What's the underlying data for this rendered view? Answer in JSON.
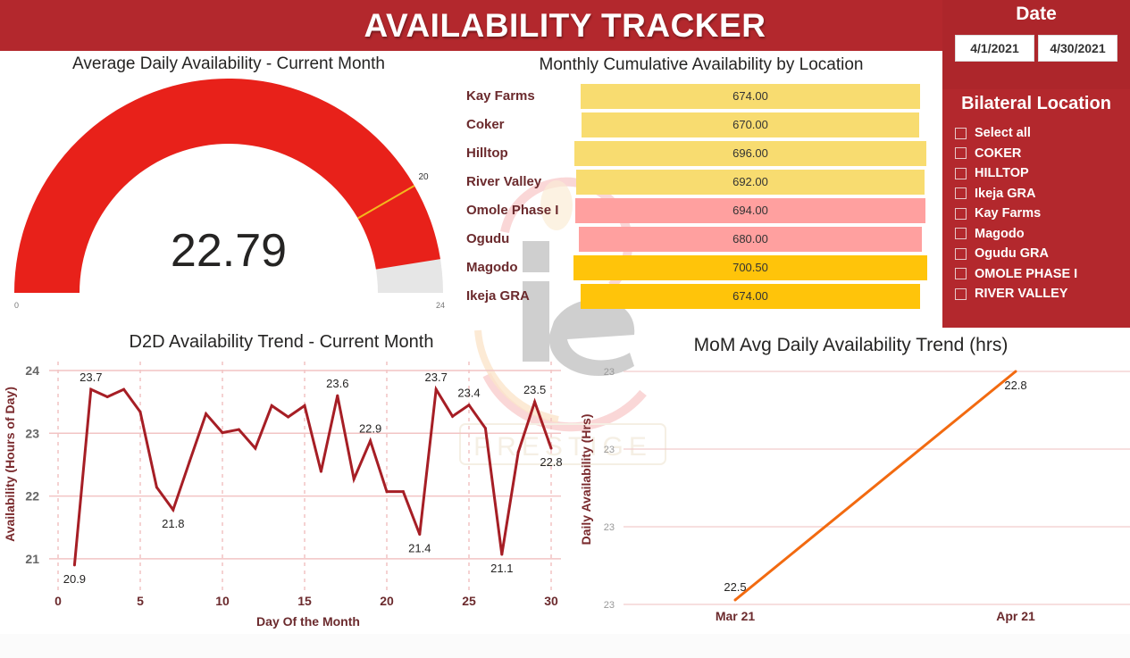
{
  "header": {
    "title": "AVAILABILITY TRACKER",
    "color": "#b3282d"
  },
  "filters": {
    "date": {
      "title": "Date",
      "start": "4/1/2021",
      "end": "4/30/2021"
    },
    "location": {
      "title": "Bilateral Location",
      "items": [
        {
          "label": "Select all",
          "checked": false
        },
        {
          "label": "COKER",
          "checked": false
        },
        {
          "label": "HILLTOP",
          "checked": false
        },
        {
          "label": "Ikeja GRA",
          "checked": false
        },
        {
          "label": "Kay Farms",
          "checked": false
        },
        {
          "label": "Magodo",
          "checked": false
        },
        {
          "label": "Ogudu GRA",
          "checked": false
        },
        {
          "label": "OMOLE PHASE I",
          "checked": false
        },
        {
          "label": "RIVER VALLEY",
          "checked": false
        }
      ]
    }
  },
  "watermark": {
    "logo": "ie-logo",
    "text": "PRESTIGE"
  },
  "chart_data": [
    {
      "type": "gauge",
      "title": "Average Daily Availability - Current Month",
      "value": 22.79,
      "value_label": "22.79",
      "min": 0,
      "min_label": "0",
      "max": 24,
      "max_label": "24",
      "target": 20,
      "target_label": "20",
      "colors": {
        "fill": "#e8211a",
        "track": "#e6e6e6",
        "target": "#f2b81d"
      }
    },
    {
      "type": "bar",
      "title": "Monthly Cumulative Availability by Location",
      "categories": [
        "Kay Farms",
        "Coker",
        "Hilltop",
        "River Valley",
        "Omole Phase I",
        "Ogudu",
        "Magodo",
        "Ikeja GRA"
      ],
      "values": [
        674.0,
        670.0,
        696.0,
        692.0,
        694.0,
        680.0,
        700.5,
        674.0
      ],
      "value_labels": [
        "674.00",
        "670.00",
        "696.00",
        "692.00",
        "694.00",
        "680.00",
        "700.50",
        "674.00"
      ],
      "colors": [
        "#f8dc70",
        "#f8dc70",
        "#f8dc70",
        "#f8dc70",
        "#ffa09f",
        "#ffa09f",
        "#ffc40a",
        "#ffc40a"
      ],
      "orientation": "horizontal-centered"
    },
    {
      "type": "line",
      "title": "D2D Availability Trend - Current Month",
      "xlabel": "Day Of the Month",
      "ylabel": "Availability (Hours of Day)",
      "x": [
        1,
        2,
        3,
        4,
        5,
        6,
        7,
        8,
        9,
        10,
        11,
        12,
        13,
        14,
        15,
        16,
        17,
        18,
        19,
        20,
        21,
        22,
        23,
        24,
        25,
        26,
        27,
        28,
        29,
        30
      ],
      "y": [
        20.9,
        23.7,
        23.58,
        23.7,
        23.34,
        22.14,
        21.78,
        22.55,
        23.31,
        23.01,
        23.06,
        22.76,
        23.44,
        23.26,
        23.44,
        22.39,
        23.6,
        22.27,
        22.88,
        22.07,
        22.07,
        21.39,
        23.7,
        23.27,
        23.45,
        23.08,
        21.07,
        22.7,
        23.5,
        22.76
      ],
      "labels": [
        {
          "x": 1,
          "text": "20.9",
          "pos": "below"
        },
        {
          "x": 2,
          "text": "23.7",
          "pos": "above"
        },
        {
          "x": 7,
          "text": "21.8",
          "pos": "below"
        },
        {
          "x": 17,
          "text": "23.6",
          "pos": "above"
        },
        {
          "x": 19,
          "text": "22.9",
          "pos": "above"
        },
        {
          "x": 22,
          "text": "21.4",
          "pos": "below"
        },
        {
          "x": 23,
          "text": "23.7",
          "pos": "above"
        },
        {
          "x": 25,
          "text": "23.4",
          "pos": "above"
        },
        {
          "x": 27,
          "text": "21.1",
          "pos": "below"
        },
        {
          "x": 29,
          "text": "23.5",
          "pos": "above"
        },
        {
          "x": 30,
          "text": "22.8",
          "pos": "below"
        }
      ],
      "xlim": [
        0,
        30
      ],
      "ylim": [
        20.6,
        24
      ],
      "xticks": [
        0,
        5,
        10,
        15,
        20,
        25,
        30
      ],
      "yticks": [
        21,
        22,
        23,
        24
      ],
      "grid": true,
      "color": "#a61e25"
    },
    {
      "type": "line",
      "title": "MoM Avg Daily Availability Trend (hrs)",
      "xlabel": "",
      "ylabel": "Daily Availability (Hrs)",
      "categories": [
        "Mar 21",
        "Apr 21"
      ],
      "values": [
        22.5,
        22.8
      ],
      "value_labels": [
        "22.5",
        "22.8"
      ],
      "ylim": [
        22.5,
        22.8
      ],
      "ytick_labels": [
        "23",
        "23",
        "23",
        "23"
      ],
      "grid": true,
      "color": "#f26a10"
    }
  ]
}
